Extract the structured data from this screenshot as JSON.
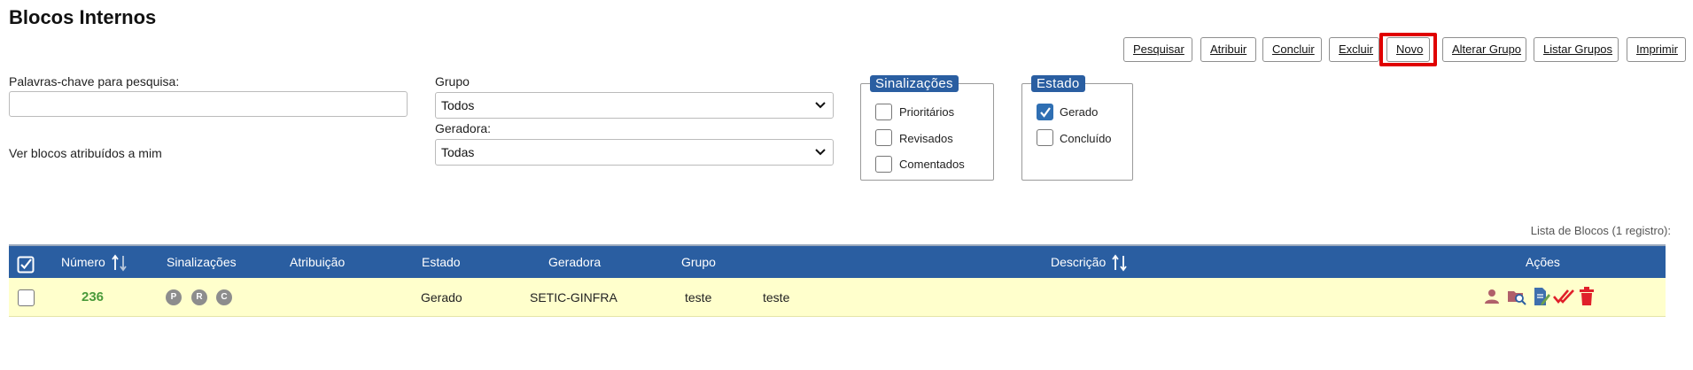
{
  "page": {
    "title": "Blocos Internos"
  },
  "toolbar": {
    "pesquisar": "Pesquisar",
    "atribuir": "Atribuir",
    "concluir": "Concluir",
    "excluir": "Excluir",
    "novo": "Novo",
    "alterar_grupo": "Alterar Grupo",
    "listar_grupos": "Listar Grupos",
    "imprimir": "Imprimir",
    "highlighted": "novo"
  },
  "filters": {
    "keywords_label": "Palavras-chave para pesquisa:",
    "keywords_value": "",
    "ver_blocos_label": "Ver blocos atribuídos a mim",
    "grupo_label": "Grupo",
    "grupo_value": "Todos",
    "geradora_label": "Geradora:",
    "geradora_value": "Todas"
  },
  "sinalizacoes": {
    "legend": "Sinalizações",
    "options": [
      {
        "label": "Prioritários",
        "checked": false
      },
      {
        "label": "Revisados",
        "checked": false
      },
      {
        "label": "Comentados",
        "checked": false
      }
    ]
  },
  "estado": {
    "legend": "Estado",
    "options": [
      {
        "label": "Gerado",
        "checked": true
      },
      {
        "label": "Concluído",
        "checked": false
      }
    ]
  },
  "list": {
    "caption": "Lista de Blocos (1 registro):",
    "headers": {
      "numero": "Número",
      "sinalizacoes": "Sinalizações",
      "atribuicao": "Atribuição",
      "estado": "Estado",
      "geradora": "Geradora",
      "grupo": "Grupo",
      "descricao": "Descrição",
      "acoes": "Ações"
    },
    "rows": [
      {
        "numero": "236",
        "sinalizacoes": [
          "P",
          "R",
          "C"
        ],
        "atribuicao": "",
        "estado": "Gerado",
        "geradora": "SETIC-GINFRA",
        "grupo": "teste",
        "descricao": "teste",
        "acoes": [
          "user-icon",
          "folder-search-icon",
          "edit-document-icon",
          "double-check-icon",
          "trash-icon"
        ]
      }
    ]
  },
  "colors": {
    "header_bg": "#2a5ea1",
    "row_bg": "#ffffcc",
    "number_green": "#4a9a3a",
    "action_icon": "#b0606a",
    "highlight": "#e00000"
  }
}
